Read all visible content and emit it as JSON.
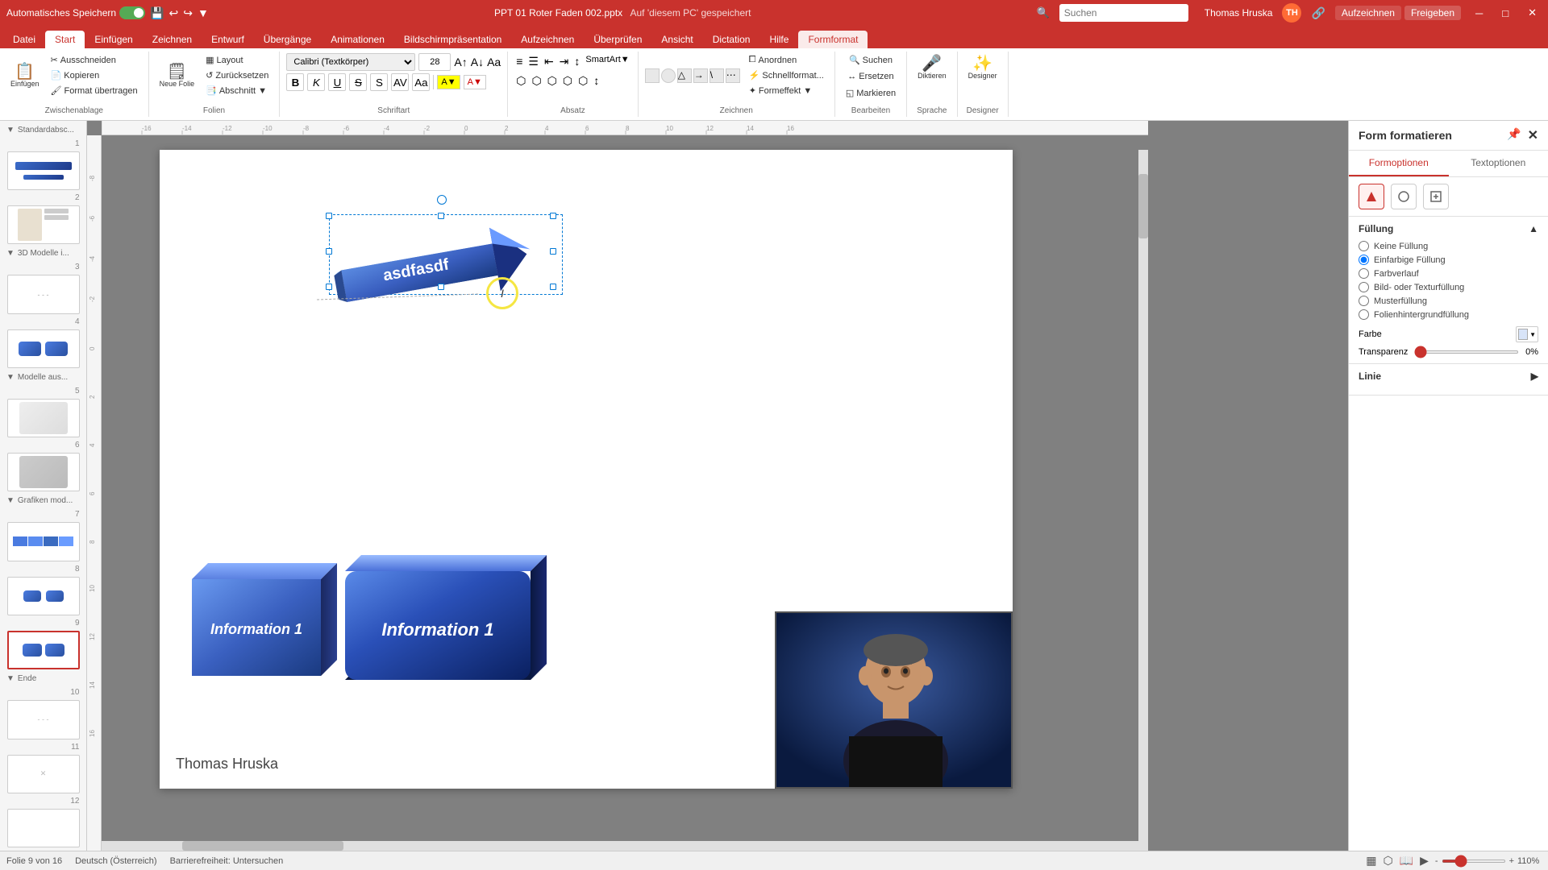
{
  "titlebar": {
    "autosave_label": "Automatisches Speichern",
    "filename": "PPT 01 Roter Faden 002.pptx",
    "saved_label": "Auf 'diesem PC' gespeichert",
    "user": "Thomas Hruska",
    "close": "✕",
    "minimize": "─",
    "maximize": "□"
  },
  "ribbon": {
    "tabs": [
      "Datei",
      "Start",
      "Einfügen",
      "Zeichnen",
      "Entwurf",
      "Übergänge",
      "Animationen",
      "Bildschirmpräsentation",
      "Aufzeichnen",
      "Überprüfen",
      "Ansicht",
      "Dictation",
      "Hilfe",
      "Formformat"
    ],
    "active_tab": "Start",
    "font_name": "Calibri (Textkörper)",
    "font_size": "28",
    "groups": {
      "zwischenablage": "Zwischenablage",
      "folien": "Folien",
      "schriftart": "Schriftart",
      "absatz": "Absatz",
      "zeichnen": "Zeichnen",
      "bearbeiten": "Bearbeiten",
      "sprache": "Sprache",
      "designer_label": "Designer"
    },
    "buttons": {
      "ausschneiden": "Ausschneiden",
      "kopieren": "Kopieren",
      "zuruecksetzen": "Zurücksetzen",
      "format_uebertragen": "Format übertragen",
      "neue_folie": "Neue Folie",
      "layout": "Layout",
      "diktieren": "Diktieren",
      "designer": "Designer",
      "suchen": "Suchen",
      "ersetzen": "Ersetzen",
      "markieren": "Markieren"
    }
  },
  "format_panel": {
    "title": "Form formatieren",
    "close": "✕",
    "tabs": [
      "Formoptionen",
      "Textoptionen"
    ],
    "icons": [
      "pentagon",
      "circle",
      "grid"
    ],
    "active_icon": 0,
    "sections": {
      "fuellung": {
        "label": "Füllung",
        "options": [
          "Keine Füllung",
          "Einfarbige Füllung",
          "Farbverlauf",
          "Bild- oder Texturfüllung",
          "Musterfüllung",
          "Folienhintergrundfüllung"
        ],
        "active": "Einfarbige Füllung",
        "farbe_label": "Farbe",
        "transparenz_label": "Transparenz",
        "transparenz_value": "0%"
      },
      "linie": {
        "label": "Linie"
      }
    }
  },
  "slide": {
    "shape_text": "asdfasdf",
    "info_box1_text": "Information 1",
    "info_box2_text": "Information 1",
    "presenter_name": "Thomas Hruska"
  },
  "statusbar": {
    "slide_info": "Folie 9 von 16",
    "language": "Deutsch (Österreich)",
    "accessibility": "Barrierefreiheit: Untersuchen",
    "zoom": "110%",
    "record_label": "Aufzeichnen",
    "freigeben_label": "Freigeben"
  },
  "slides_panel": {
    "groups": [
      {
        "label": "Standardabsc...",
        "slides": [
          {
            "num": 1
          },
          {
            "num": 2
          }
        ]
      },
      {
        "label": "3D Modelle i...",
        "slides": [
          {
            "num": 3
          },
          {
            "num": 4,
            "has_3d": true
          }
        ]
      },
      {
        "label": "Modelle aus...",
        "slides": [
          {
            "num": 5
          },
          {
            "num": 6
          }
        ]
      },
      {
        "label": "Grafiken mod...",
        "slides": [
          {
            "num": 7
          },
          {
            "num": 8
          }
        ]
      },
      {
        "label": "active_9",
        "slides": [
          {
            "num": 9,
            "active": true
          }
        ]
      },
      {
        "label": "Ende",
        "slides": [
          {
            "num": 10
          },
          {
            "num": 11
          }
        ]
      },
      {
        "label": "",
        "slides": [
          {
            "num": 12
          }
        ]
      }
    ]
  },
  "search": {
    "placeholder": "Suchen"
  }
}
